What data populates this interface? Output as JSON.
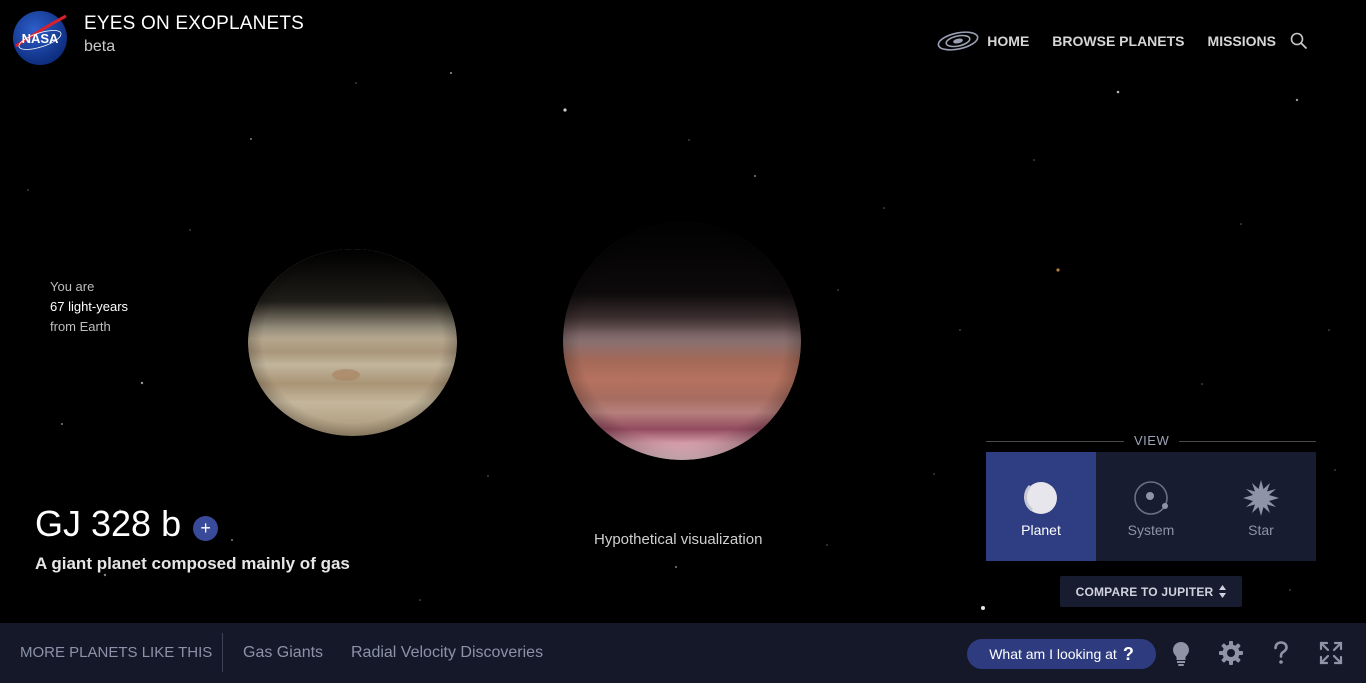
{
  "header": {
    "logo_text": "NASA",
    "app_title": "EYES ON EXOPLANETS",
    "app_subtitle": "beta",
    "nav": [
      {
        "label": "HOME",
        "icon": "galaxy-icon"
      },
      {
        "label": "BROWSE PLANETS"
      },
      {
        "label": "MISSIONS"
      }
    ],
    "search_icon": "search-icon"
  },
  "distance": {
    "prefix": "You are",
    "value": "67 light-years",
    "suffix": "from Earth"
  },
  "planet": {
    "name": "GJ 328 b",
    "add_label": "+",
    "description": "A giant planet composed mainly of gas",
    "visualization_note": "Hypothetical visualization"
  },
  "view": {
    "label": "VIEW",
    "options": [
      {
        "label": "Planet",
        "icon": "planet-icon",
        "active": true
      },
      {
        "label": "System",
        "icon": "system-icon",
        "active": false
      },
      {
        "label": "Star",
        "icon": "star-icon",
        "active": false
      }
    ],
    "compare_label": "COMPARE TO JUPITER"
  },
  "bottom": {
    "more_label": "MORE PLANETS LIKE THIS",
    "categories": [
      "Gas Giants",
      "Radial Velocity Discoveries"
    ],
    "looking_label": "What am I looking at",
    "looking_symbol": "?",
    "icons": [
      "lightbulb-icon",
      "gear-icon",
      "help-icon",
      "fullscreen-icon"
    ]
  },
  "colors": {
    "accent": "#2f3d82",
    "bar": "#141829",
    "panel": "#181c30"
  }
}
